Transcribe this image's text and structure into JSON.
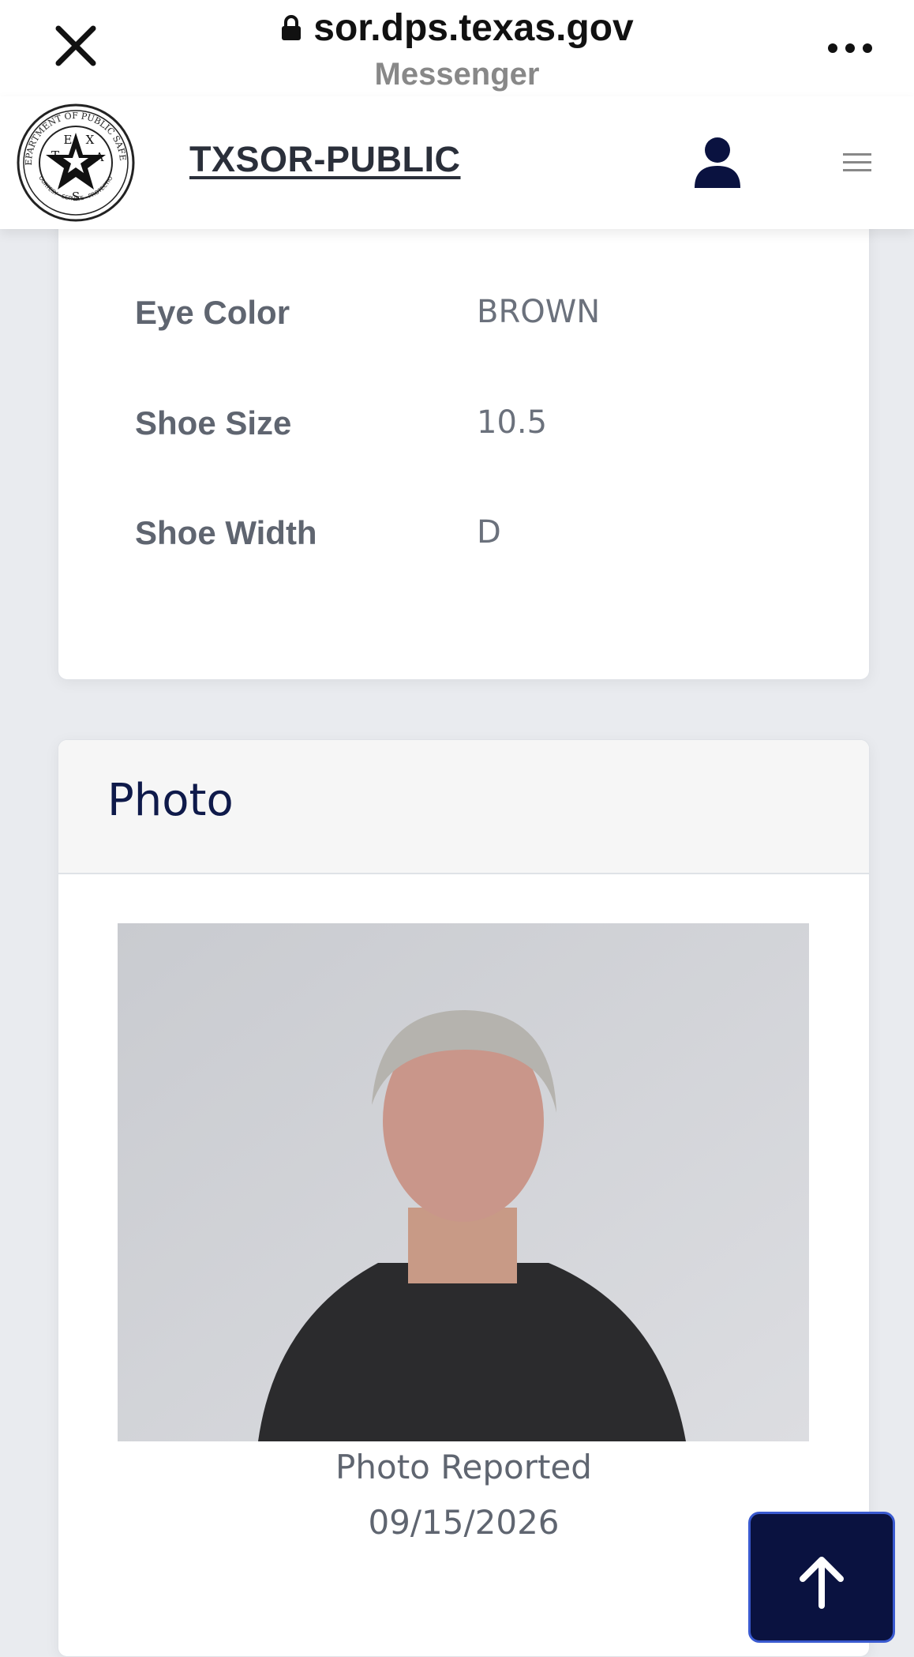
{
  "browser": {
    "url": "sor.dps.texas.gov",
    "app_name": "Messenger"
  },
  "site": {
    "title": "TXSOR-PUBLIC",
    "seal_text": {
      "top": "DEPARTMENT OF PUBLIC SAFETY",
      "bottom": "COURTESY · SERVICE · PROTECTION",
      "letters": [
        "T",
        "E",
        "X",
        "A",
        "S"
      ]
    }
  },
  "details": [
    {
      "label": "Eye Color",
      "value": "BROWN"
    },
    {
      "label": "Shoe Size",
      "value": "10.5"
    },
    {
      "label": "Shoe Width",
      "value": "D"
    }
  ],
  "photo_section": {
    "heading": "Photo",
    "caption_line1": "Photo Reported",
    "caption_line2": "09/15/2026"
  },
  "colors": {
    "navy": "#0a1240",
    "heading_navy": "#0f1a4a",
    "page_bg": "#e9ebef"
  },
  "icons": [
    "close-icon",
    "lock-icon",
    "more-icon",
    "user-icon",
    "menu-icon",
    "arrow-up-icon"
  ]
}
